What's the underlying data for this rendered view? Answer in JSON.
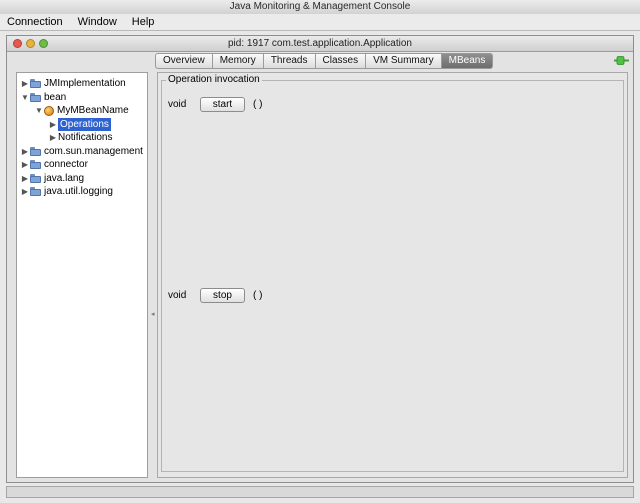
{
  "app_window": {
    "title": "Java Monitoring & Management Console"
  },
  "menubar": {
    "items": [
      "Connection",
      "Window",
      "Help"
    ]
  },
  "inner_window": {
    "title": "pid: 1917 com.test.application.Application"
  },
  "tabs": [
    {
      "label": "Overview",
      "selected": false
    },
    {
      "label": "Memory",
      "selected": false
    },
    {
      "label": "Threads",
      "selected": false
    },
    {
      "label": "Classes",
      "selected": false
    },
    {
      "label": "VM Summary",
      "selected": false
    },
    {
      "label": "MBeans",
      "selected": true
    }
  ],
  "tree": {
    "nodes": [
      {
        "label": "JMImplementation",
        "icon": "folder-icon",
        "expanded": false
      },
      {
        "label": "bean",
        "icon": "folder-icon",
        "expanded": true
      },
      {
        "label": "MyMBeanName",
        "icon": "bean-icon",
        "expanded": true
      },
      {
        "label": "Operations",
        "icon": "none",
        "selected": true
      },
      {
        "label": "Notifications",
        "icon": "none",
        "selected": false
      },
      {
        "label": "com.sun.management",
        "icon": "folder-icon",
        "expanded": false
      },
      {
        "label": "connector",
        "icon": "folder-icon",
        "expanded": false
      },
      {
        "label": "java.lang",
        "icon": "folder-icon",
        "expanded": false
      },
      {
        "label": "java.util.logging",
        "icon": "folder-icon",
        "expanded": false
      }
    ]
  },
  "operations_panel": {
    "title": "Operation invocation",
    "operations": [
      {
        "return_type": "void",
        "button_label": "start",
        "params": "( )"
      },
      {
        "return_type": "void",
        "button_label": "stop",
        "params": "( )"
      }
    ]
  },
  "colors": {
    "selected_tab": "#7a7a7a",
    "selection": "#2f62d1",
    "connected_icon": "#3aa535"
  }
}
